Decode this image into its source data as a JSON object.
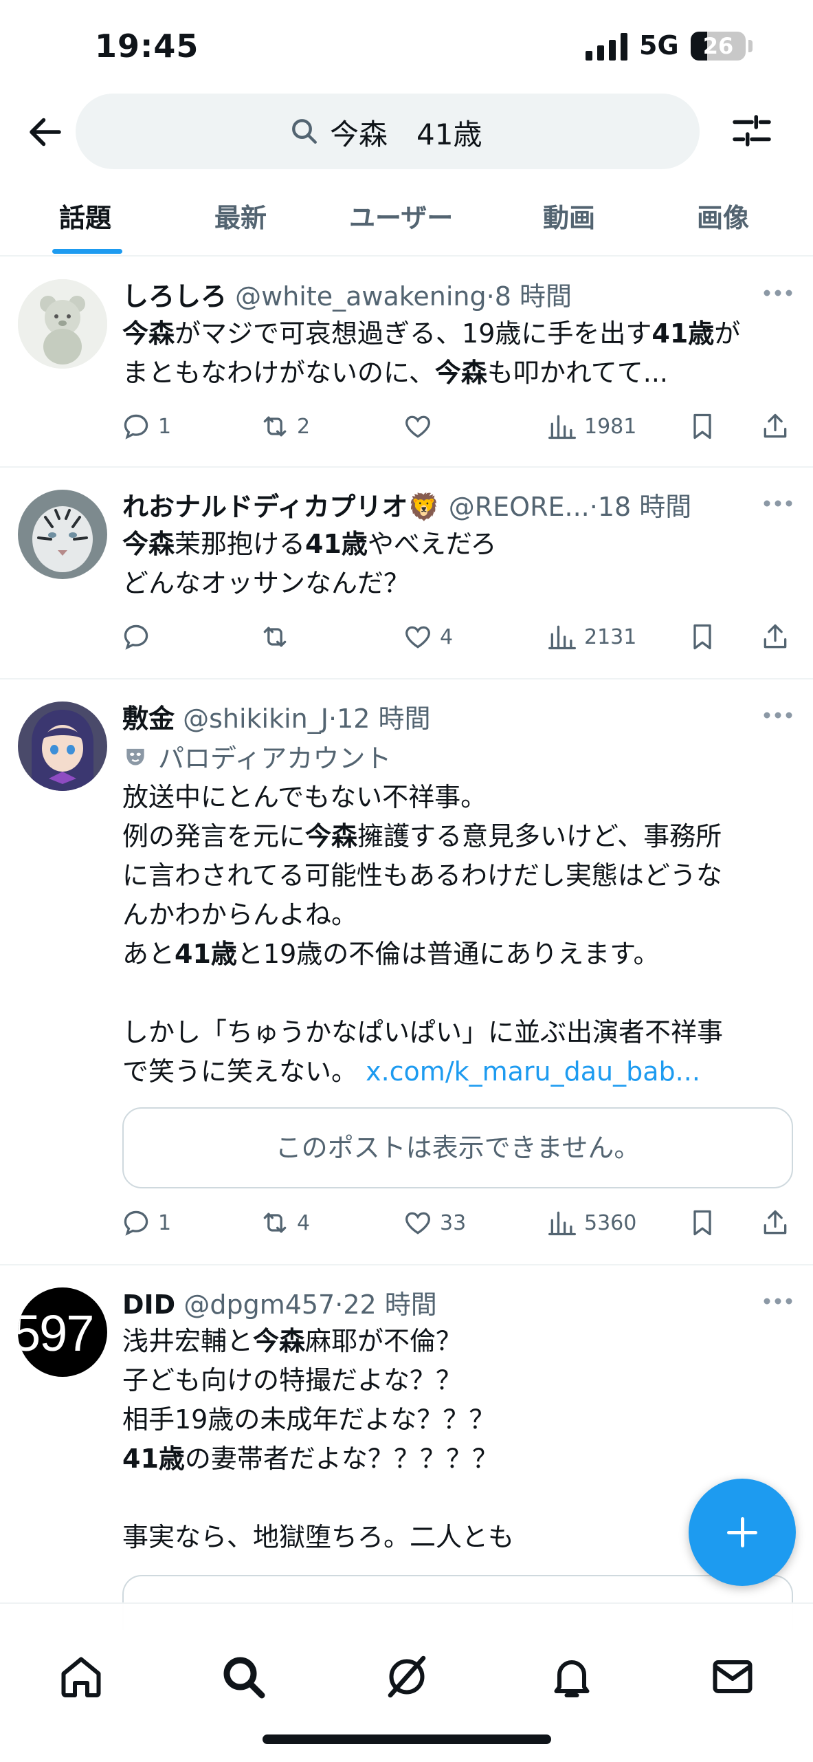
{
  "status_bar": {
    "time": "19:45",
    "network": "5G",
    "battery": "26"
  },
  "search": {
    "query": "今森　41歳"
  },
  "tabs": [
    {
      "label": "話題",
      "active": true
    },
    {
      "label": "最新",
      "active": false
    },
    {
      "label": "ユーザー",
      "active": false
    },
    {
      "label": "動画",
      "active": false
    },
    {
      "label": "画像",
      "active": false
    }
  ],
  "posts": [
    {
      "name": "しろしろ",
      "handle": "@white_awakening",
      "time": "8 時間",
      "lines": [
        [
          {
            "b": "今森"
          },
          {
            "t": "がマジで可哀想過ぎる、19歳に手を出す"
          },
          {
            "b": "41歳"
          },
          {
            "t": "が"
          }
        ],
        [
          {
            "t": "まともなわけがないのに、"
          },
          {
            "b": "今森"
          },
          {
            "t": "も叩かれてて..."
          }
        ]
      ],
      "replies": "1",
      "reposts": "2",
      "likes": "",
      "views": "1981"
    },
    {
      "name": "れおナルドディカプリオ",
      "emoji": "🦁",
      "handle": "@REORE...",
      "time": "18 時間",
      "lines": [
        [
          {
            "b": "今森"
          },
          {
            "t": "茉那抱ける"
          },
          {
            "b": "41歳"
          },
          {
            "t": "やべえだろ"
          }
        ],
        [
          {
            "t": "どんなオッサンなんだ？"
          }
        ]
      ],
      "replies": "",
      "reposts": "",
      "likes": "4",
      "views": "2131"
    },
    {
      "name": "敷金",
      "handle": "@shikikin_J",
      "time": "12 時間",
      "parody_label": "パロディアカウント",
      "lines": [
        [
          {
            "t": "放送中にとんでもない不祥事。"
          }
        ],
        [
          {
            "t": "例の発言を元に"
          },
          {
            "b": "今森"
          },
          {
            "t": "擁護する意見多いけど、事務所"
          }
        ],
        [
          {
            "t": "に言わされてる可能性もあるわけだし実態はどうな"
          }
        ],
        [
          {
            "t": "んかわからんよね。"
          }
        ],
        [
          {
            "t": "あと"
          },
          {
            "b": "41歳"
          },
          {
            "t": "と19歳の不倫は普通にありえます。"
          }
        ],
        [
          {
            "t": ""
          }
        ],
        [
          {
            "t": "しかし「ちゅうかなぱいぱい」に並ぶ出演者不祥事"
          }
        ],
        [
          {
            "t": "で笑うに笑えない。 "
          },
          {
            "l": "x.com/k_maru_dau_bab..."
          }
        ]
      ],
      "quote_unavailable": "このポストは表示できません。",
      "replies": "1",
      "reposts": "4",
      "likes": "33",
      "views": "5360"
    },
    {
      "name": "DID",
      "handle": "@dpgm457",
      "time": "22 時間",
      "avatar_text": "597",
      "lines": [
        [
          {
            "t": "浅井宏輔と"
          },
          {
            "b": "今森"
          },
          {
            "t": "麻耶が不倫？"
          }
        ],
        [
          {
            "t": "子ども向けの特撮だよな？？"
          }
        ],
        [
          {
            "t": "相手19歳の未成年だよな？？？"
          }
        ],
        [
          {
            "b": "41歳"
          },
          {
            "t": "の妻帯者だよな？？？？？"
          }
        ],
        [
          {
            "t": ""
          }
        ],
        [
          {
            "t": "事実なら、地獄堕ちろ。二人とも"
          }
        ]
      ]
    }
  ]
}
